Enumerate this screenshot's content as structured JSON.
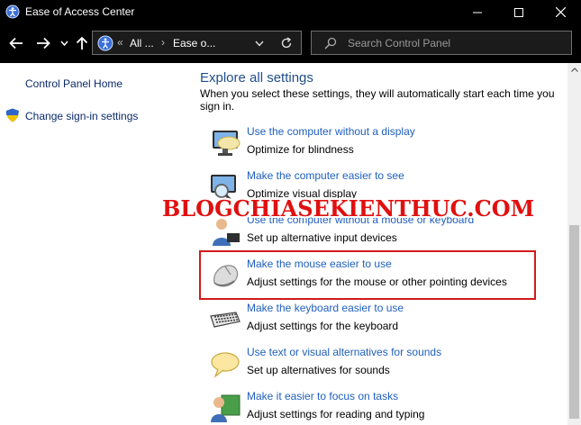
{
  "window": {
    "title": "Ease of Access Center",
    "minimize_icon": "minimize-icon",
    "maximize_icon": "maximize-icon",
    "close_icon": "close-icon"
  },
  "navbar": {
    "back_icon": "arrow-left-icon",
    "forward_icon": "arrow-right-icon",
    "recent_icon": "chevron-down-icon",
    "up_icon": "arrow-up-icon",
    "address": {
      "overflow": "«",
      "crumbs": [
        "All ...",
        "Ease o..."
      ],
      "separator": "›"
    },
    "refresh_icon": "refresh-icon",
    "search_placeholder": "Search Control Panel"
  },
  "sidebar": {
    "items": [
      {
        "label": "Control Panel Home"
      },
      {
        "label": "Change sign-in settings",
        "icon": "shield-icon"
      }
    ]
  },
  "main": {
    "section_title": "Explore all settings",
    "section_desc": "When you select these settings, they will automatically start each time you sign in.",
    "items": [
      {
        "link": "Use the computer without a display",
        "desc": "Optimize for blindness",
        "icon": "monitor-icon"
      },
      {
        "link": "Make the computer easier to see",
        "desc": "Optimize visual display",
        "icon": "magnifier-monitor-icon"
      },
      {
        "link": "Use the computer without a mouse or keyboard",
        "desc": "Set up alternative input devices",
        "icon": "person-icon"
      },
      {
        "link": "Make the mouse easier to use",
        "desc": "Adjust settings for the mouse or other pointing devices",
        "icon": "mouse-icon"
      },
      {
        "link": "Make the keyboard easier to use",
        "desc": "Adjust settings for the keyboard",
        "icon": "keyboard-icon"
      },
      {
        "link": "Use text or visual alternatives for sounds",
        "desc": "Set up alternatives for sounds",
        "icon": "speech-bubble-icon"
      },
      {
        "link": "Make it easier to focus on tasks",
        "desc": "Adjust settings for reading and typing",
        "icon": "person-screen-icon"
      }
    ]
  },
  "watermark": "BLOGCHIASEKIENTHUC.COM",
  "colors": {
    "titlebar": "#000000",
    "link": "#1f5fbf",
    "section_title": "#1f4e8c",
    "highlight": "#d11a1a",
    "watermark": "#e01010"
  }
}
